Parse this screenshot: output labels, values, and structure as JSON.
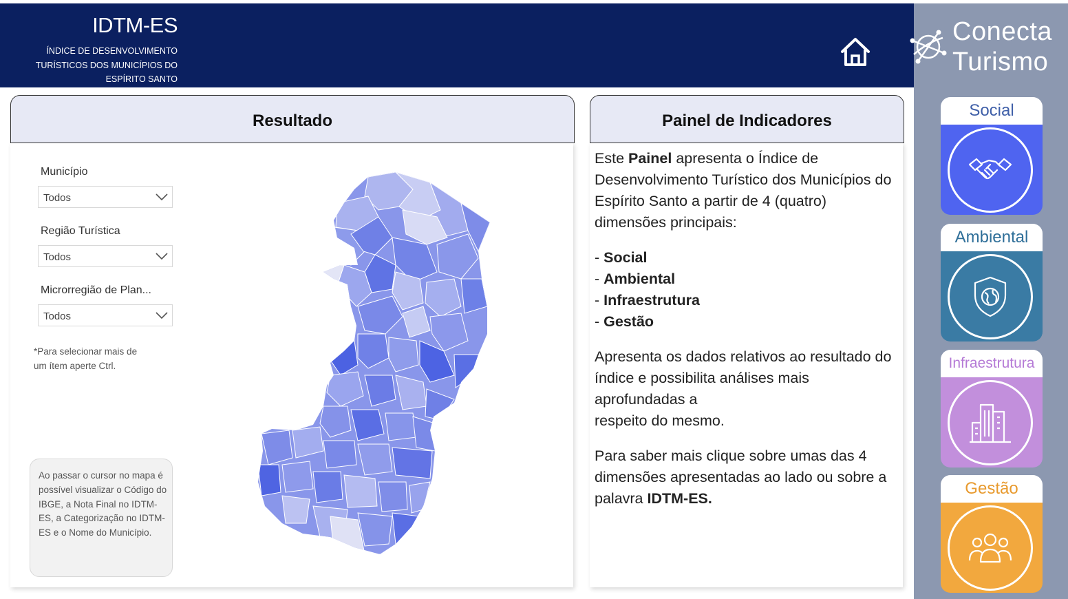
{
  "header": {
    "title": "IDTM-ES",
    "subtitle_lines": [
      "ÍNDICE DE DESENVOLVIMENTO",
      "TURÍSTICOS DOS MUNICÍPIOS DO",
      "ESPÍRITO SANTO"
    ],
    "logo_line1": "Conecta",
    "logo_line2": "Turismo",
    "home_icon": "home-icon"
  },
  "left_panel": {
    "title": "Resultado",
    "filters": [
      {
        "label": "Município",
        "value": "Todos"
      },
      {
        "label": "Região Turística",
        "value": "Todos"
      },
      {
        "label": "Microrregião de Plan...",
        "value": "Todos"
      }
    ],
    "note_lines": [
      "*Para selecionar mais de",
      "um ítem aperte Ctrl."
    ],
    "info_text": "Ao passar o cursor no mapa é possível visualizar o Código do IBGE, a Nota Final no IDTM-ES, a Categorização no IDTM-ES e o Nome do Município."
  },
  "right_text_panel": {
    "title": "Painel de Indicadores",
    "intro_bold": "Painel",
    "intro_pre": "Este ",
    "intro_rest": " apresenta o Índice de Desenvolvimento Turístico dos Municípios do Espírito Santo a partir de 4 (quatro) dimensões principais:",
    "dimensions": [
      "Social",
      "Ambiental",
      "Infraestrutura",
      "Gestão"
    ],
    "para2_lines": [
      "Apresenta os dados relativos ao resultado do índice e possibilita análises mais aprofundadas a",
      "respeito do mesmo."
    ],
    "para3_pre": "Para saber mais clique sobre umas das 4 dimensões apresentadas ao lado ou sobre a palavra ",
    "para3_bold": "IDTM-ES."
  },
  "dimension_cards": [
    {
      "label": "Social",
      "color": "#4f64f0",
      "label_color": "#3f5fa8",
      "icon": "handshake-icon"
    },
    {
      "label": "Ambiental",
      "color": "#3a7ba4",
      "label_color": "#2f6f99",
      "icon": "shield-globe-icon"
    },
    {
      "label": "Infraestrutura",
      "color": "#c28fdc",
      "label_color": "#b57ad6",
      "icon": "buildings-icon"
    },
    {
      "label": "Gestão",
      "color": "#f2a83e",
      "label_color": "#e89a2e",
      "icon": "people-group-icon"
    }
  ]
}
